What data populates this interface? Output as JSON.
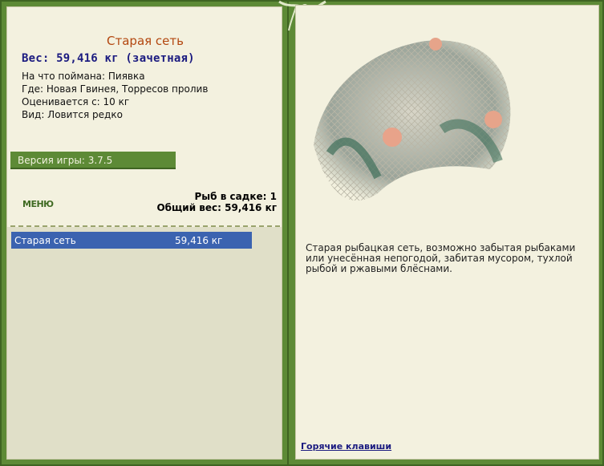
{
  "fish": {
    "title": "Старая сеть",
    "weight_line": "Вес: 59,416 кг (зачетная)",
    "bait": "На что поймана: Пиявка",
    "location": "Где: Новая Гвинея, Торресов пролив",
    "valued_from": "Оценивается с: 10 кг",
    "kind": "Вид: Ловится редко"
  },
  "version": "Версия игры: 3.7.5",
  "menu_label": "МЕНЮ",
  "keepnet": {
    "count": "Рыб в садке: 1",
    "total": "Общий вес: 59,416 кг"
  },
  "catch_list": [
    {
      "name": "Старая сеть",
      "weight": "59,416 кг"
    }
  ],
  "description": "Старая рыбацкая сеть, возможно забытая рыбаками или унесённая непогодой, забитая мусором, тухлой рыбой и ржавыми блёснами.",
  "hotkeys_label": "Горячие клавиши",
  "colors": {
    "frame": "#5d8a36",
    "panel": "#f3f1df",
    "title": "#b3470f",
    "weight": "#1b1b80",
    "selected_row": "#3b63b0"
  }
}
